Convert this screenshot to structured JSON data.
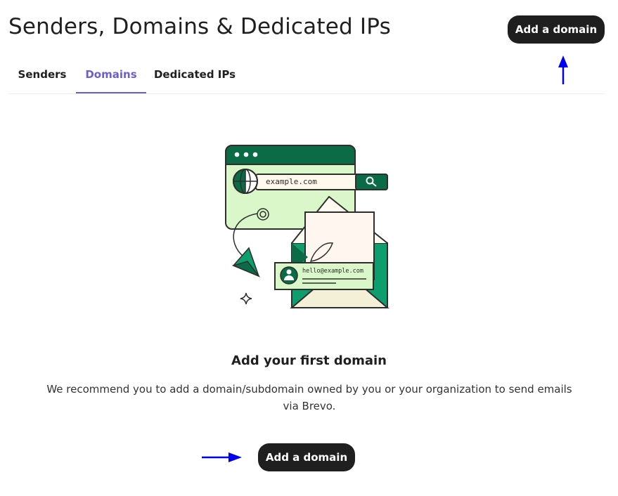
{
  "header": {
    "title": "Senders, Domains & Dedicated IPs",
    "add_button_label": "Add a domain"
  },
  "tabs": [
    {
      "label": "Senders",
      "active": false
    },
    {
      "label": "Domains",
      "active": true
    },
    {
      "label": "Dedicated IPs",
      "active": false
    }
  ],
  "illustration": {
    "url_text": "example.com",
    "email_text": "hello@example.com"
  },
  "empty_state": {
    "title": "Add your first domain",
    "description": "We recommend you to add a domain/subdomain owned by you or your organization to send emails via Brevo.",
    "button_label": "Add a domain"
  },
  "colors": {
    "accent": "#6a5fd1",
    "button_bg": "#1f1f1f",
    "illustration_green": "#0e9e6e",
    "illustration_dark_green": "#0b6b47",
    "illustration_light_green": "#d9f7c8",
    "annotation_arrow": "#0000ee"
  },
  "icons": [
    "globe-icon",
    "search-icon",
    "paper-plane-icon",
    "sparkle-icon",
    "user-avatar-icon",
    "envelope-icon",
    "leaf-icon"
  ]
}
